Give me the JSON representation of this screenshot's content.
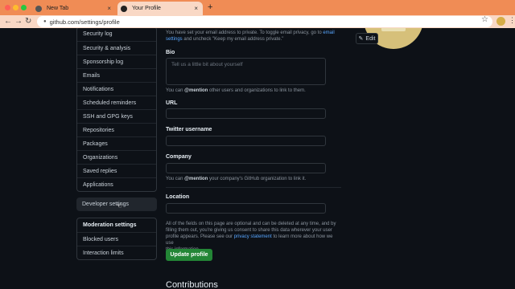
{
  "browser": {
    "tabs": [
      {
        "label": "New Tab",
        "active": false
      },
      {
        "label": "Your Profile",
        "active": true
      }
    ],
    "new_tab_symbol": "+",
    "close_symbol": "×",
    "url": "github.com/settings/profile",
    "back": "←",
    "forward": "→",
    "reload": "↻",
    "star": "☆",
    "menu": "⋮"
  },
  "sidebar": {
    "group1": [
      "Security log",
      "Security & analysis",
      "Sponsorship log",
      "Emails",
      "Notifications",
      "Scheduled reminders",
      "SSH and GPG keys",
      "Repositories",
      "Packages",
      "Organizations",
      "Saved replies",
      "Applications"
    ],
    "developer_settings": "Developer settings",
    "group2_heading": "Moderation settings",
    "group2": [
      "Blocked users",
      "Interaction limits"
    ]
  },
  "form": {
    "email_note_1": "You have set your email address to private. To toggle email privacy, go to",
    "email_note_link1": "email",
    "email_note_link2": "settings",
    "email_note_2": "and uncheck \"Keep my email address private.\"",
    "bio_label": "Bio",
    "bio_placeholder": "Tell us a little bit about yourself",
    "bio_help_pre": "You can",
    "bio_help_mention": "@mention",
    "bio_help_post": "other users and organizations to link to them.",
    "url_label": "URL",
    "twitter_label": "Twitter username",
    "company_label": "Company",
    "company_help_pre": "You can",
    "company_help_mention": "@mention",
    "company_help_post": "your company's GitHub organization to link it.",
    "location_label": "Location",
    "privacy_note_1": "All of the fields on this page are optional and can be deleted at any time, and by",
    "privacy_note_2": "filling them out, you're giving us consent to share this data wherever your user",
    "privacy_note_3a": "profile appears. Please see our",
    "privacy_note_link": "privacy statement",
    "privacy_note_3b": "to learn more about how we use",
    "privacy_note_4": "this information.",
    "update_button": "Update profile",
    "contributions_heading": "Contributions"
  },
  "avatar": {
    "edit_label": "Edit",
    "edit_icon": "pencil-icon"
  },
  "colors": {
    "background": "#0d1117",
    "accent_link": "#58a6ff",
    "button_green": "#238636",
    "browser_tab_bar": "#f08c55"
  }
}
